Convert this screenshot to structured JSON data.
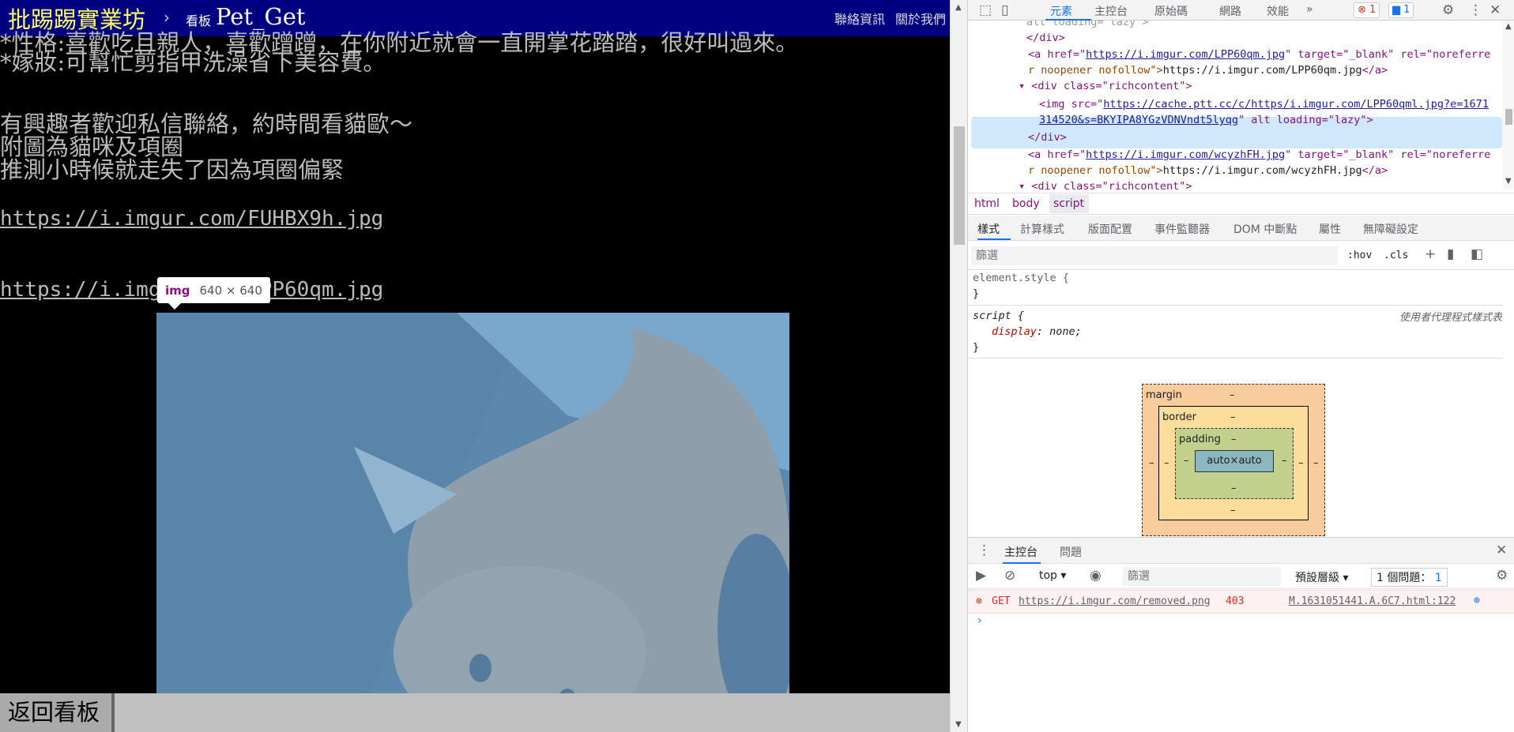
{
  "page": {
    "site_title": "批踢踢實業坊",
    "crumb_arrow": "›",
    "board_prefix": "看板",
    "board_name": "Pet_Get",
    "contact_link": "聯絡資訊",
    "about_link": "關於我們",
    "content_lines": [
      "*性格:喜歡吃且親人，喜歡蹭蹭，在你附近就會一直開掌花踏踏，很好叫過來。",
      "*嫁妝:可幫忙剪指甲洗澡省下美容費。",
      "有興趣者歡迎私信聯絡，約時間看貓歐～",
      "附圖為貓咪及項圈",
      "推測小時候就走失了因為項圈偏緊"
    ],
    "links": [
      "https://i.imgur.com/FUHBX9h.jpg",
      "https://i.imgur.com/LPP60qm.jpg"
    ],
    "tooltip_tag": "img",
    "tooltip_size": "640 × 640",
    "back_button": "返回看板"
  },
  "devtools": {
    "tabs": [
      "元素",
      "主控台",
      "原始碼",
      "網路",
      "效能",
      "»"
    ],
    "error_count": "1",
    "message_count": "1",
    "dom": {
      "close_div": "</div>",
      "a_prefix": "<a href=\"",
      "a1_href": "https://i.imgur.com/LPP60qm.jpg",
      "a_mid": "\" target=\"_blank\" rel=\"noreferre",
      "a_cont": "r noopener nofollow\">",
      "a1_text": "https://i.imgur.com/LPP60qm.jpg",
      "a_close": "</a>",
      "div_rich": "<div class=\"richcontent\">",
      "img_prefix": "<img src=\"",
      "img_src_1": "https://cache.ptt.cc/c/https/i.imgur.com/LPP60qml.jpg?e=1671",
      "img_src_2": "314520&s=BKYIPA8YGzVDNVndt5lyqg",
      "img_suffix": "\" alt loading=\"lazy\">",
      "a2_href": "https://i.imgur.com/wcyzhFH.jpg",
      "a2_text": "https://i.imgur.com/wcyzhFH.jpg",
      "top_partial": "alt loading=\"lazy\">"
    },
    "crumbs": [
      "html",
      "body",
      "script"
    ],
    "sub_tabs": [
      "樣式",
      "計算樣式",
      "版面配置",
      "事件監聽器",
      "DOM 中斷點",
      "屬性",
      "無障礙設定"
    ],
    "styles_filter_placeholder": "篩選",
    "hov": ":hov",
    "cls": ".cls",
    "rules": {
      "element_style": "element.style {",
      "close_brace": "}",
      "script_sel": "script {",
      "prop_name": "display",
      "prop_value": "none;",
      "ua_source": "使用者代理程式樣式表"
    },
    "box_model": {
      "margin": "margin",
      "border": "border",
      "padding": "padding",
      "content": "auto×auto",
      "dash": "–"
    },
    "console": {
      "tabs": [
        "主控台",
        "問題"
      ],
      "context": "top",
      "filter_placeholder": "篩選",
      "levels": "預設層級",
      "issues": "1 個問題：",
      "issues_count": "1",
      "error_method": "GET",
      "error_url": "https://i.imgur.com/removed.png",
      "error_code": "403",
      "error_source": "M.1631051441.A.6C7.html:122",
      "prompt": "›"
    }
  },
  "colors": {
    "topbar": "#000080",
    "site_title": "#ffff66",
    "highlight": "#6fa8dc",
    "accent": "#1a73e8"
  }
}
